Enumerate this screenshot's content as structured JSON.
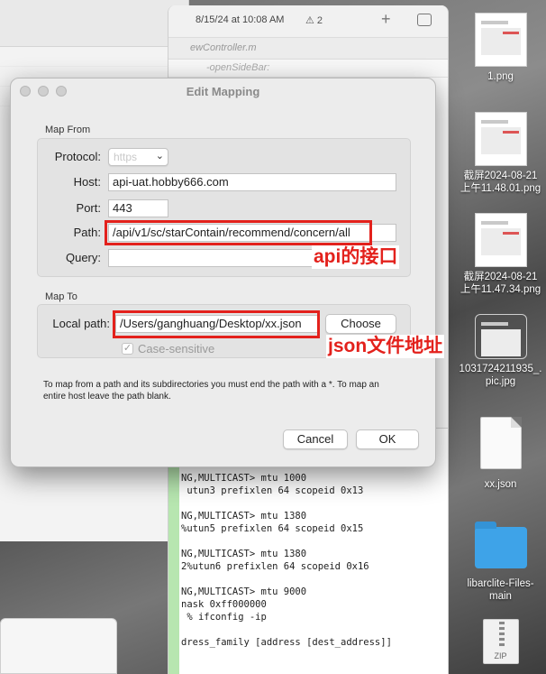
{
  "background": {
    "xcode_date": "8/15/24 at 10:08 AM",
    "xcode_warnings": "2",
    "xcode_tab": "ewController.m",
    "xcode_breadcrumb": "-openSideBar:",
    "console_text": "NG,MULTICAST> mtu 1000\n utun3 prefixlen 64 scopeid 0x13\n\nNG,MULTICAST> mtu 1380\n%utun5 prefixlen 64 scopeid 0x15\n\nNG,MULTICAST> mtu 1380\n2%utun6 prefixlen 64 scopeid 0x16\n\nNG,MULTICAST> mtu 9000\nnask 0xff000000\n % ifconfig -ip\n\ndress_family [address [dest_address]]\n\n\n[-u] [-v] [address_family]"
  },
  "desktop": {
    "items": [
      {
        "label": "1.png",
        "kind": "image"
      },
      {
        "label": "截屏2024-08-21\n上午11.48.01.png",
        "kind": "image"
      },
      {
        "label": "截屏2024-08-21\n上午11.47.34.png",
        "kind": "image"
      },
      {
        "label": "1031724211935_.\npic.jpg",
        "kind": "image"
      },
      {
        "label": "xx.json",
        "kind": "document"
      },
      {
        "label": "libarclite-Files-\nmain",
        "kind": "folder"
      },
      {
        "label": "",
        "kind": "zip",
        "badge": "ZIP"
      }
    ]
  },
  "dialog": {
    "title": "Edit Mapping",
    "map_from": {
      "section_label": "Map From",
      "protocol_label": "Protocol:",
      "protocol_value": "https",
      "host_label": "Host:",
      "host_value": "api-uat.hobby666.com",
      "port_label": "Port:",
      "port_value": "443",
      "path_label": "Path:",
      "path_value": "/api/v1/sc/starContain/recommend/concern/all",
      "query_label": "Query:",
      "query_value": ""
    },
    "map_to": {
      "section_label": "Map To",
      "local_path_label": "Local path:",
      "local_path_value": "/Users/ganghuang/Desktop/xx.json",
      "choose_button": "Choose",
      "case_sensitive_label": "Case-sensitive",
      "case_sensitive_checked": true
    },
    "help_text": "To map from a path and its subdirectories you must end the path with a *. To map an entire host leave the path blank.",
    "cancel_button": "Cancel",
    "ok_button": "OK"
  },
  "annotations": {
    "api_note": "api的接口",
    "json_note": "json文件地址",
    "color": "#e3211c"
  }
}
